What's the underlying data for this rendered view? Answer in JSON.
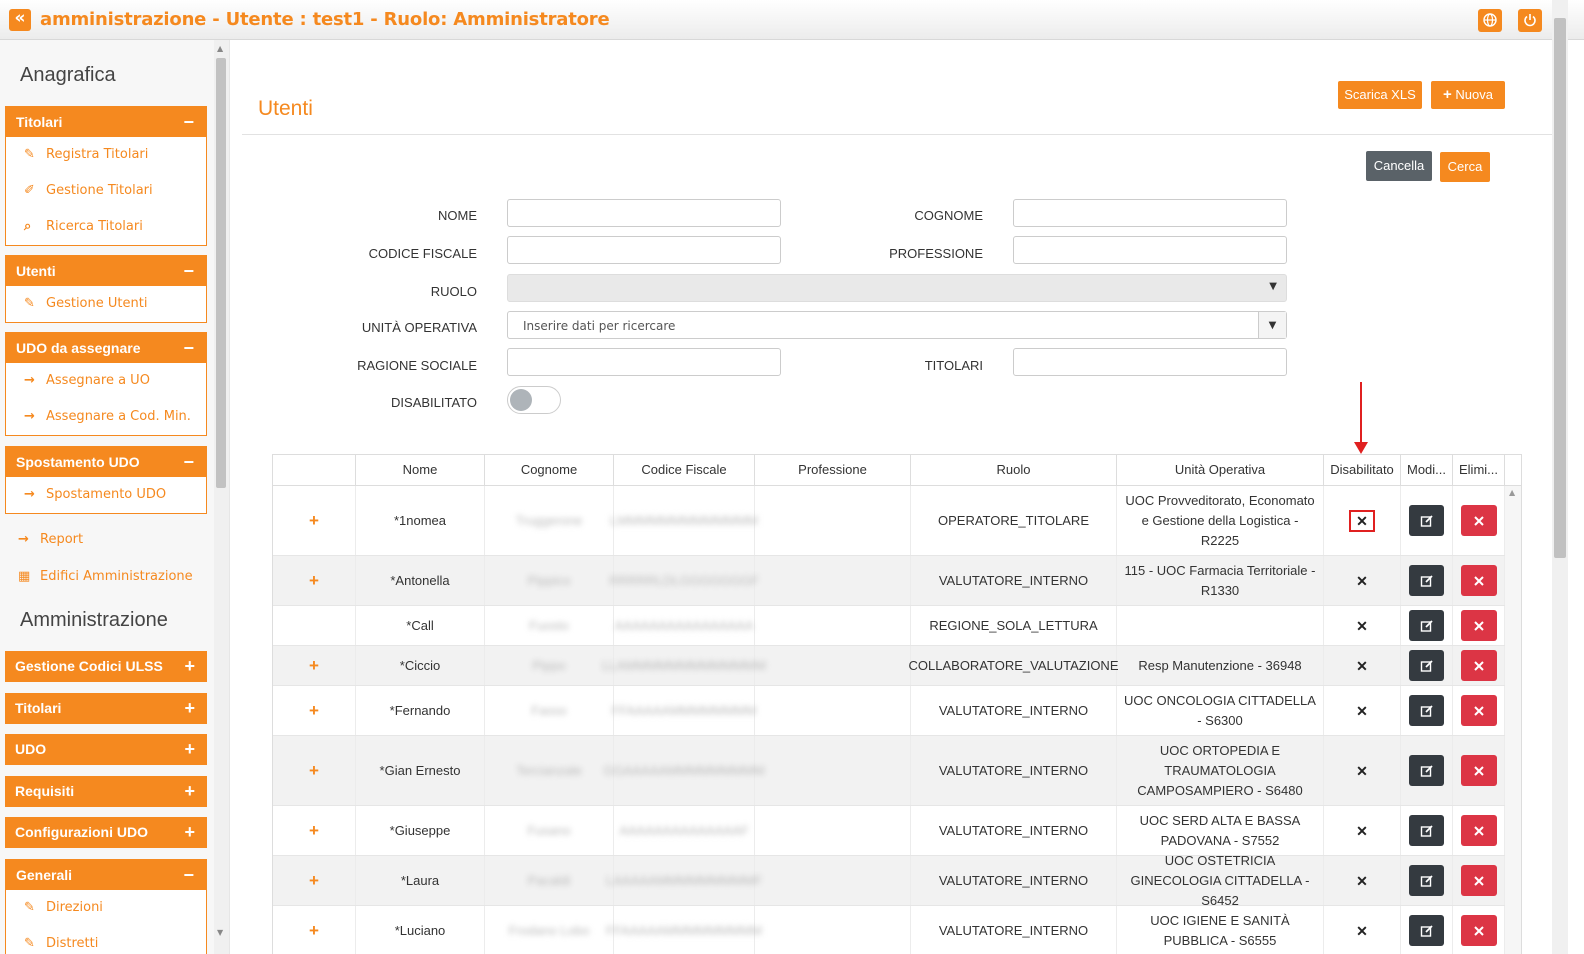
{
  "topbar": {
    "collapse_icon": "«",
    "title": "amministrazione - Utente : test1 - Ruolo: Amministratore",
    "globe_icon": "globe-icon",
    "power_icon": "power-icon"
  },
  "sidebar": {
    "section1": "Anagrafica",
    "titolari": {
      "label": "Titolari",
      "sign": "−",
      "items": [
        {
          "icon": "user-edit-icon",
          "label": "Registra Titolari"
        },
        {
          "icon": "edit-icon",
          "label": "Gestione Titolari"
        },
        {
          "icon": "search-icon",
          "label": "Ricerca Titolari"
        }
      ]
    },
    "utenti": {
      "label": "Utenti",
      "sign": "−",
      "items": [
        {
          "icon": "user-edit-icon",
          "label": "Gestione Utenti"
        }
      ]
    },
    "udo_assegnare": {
      "label": "UDO da assegnare",
      "sign": "−",
      "items": [
        {
          "icon": "arrow-right-icon",
          "label": "Assegnare a UO"
        },
        {
          "icon": "arrow-right-icon",
          "label": "Assegnare a Cod. Min."
        }
      ]
    },
    "spostamento": {
      "label": "Spostamento UDO",
      "sign": "−",
      "items": [
        {
          "icon": "arrow-right-icon",
          "label": "Spostamento UDO"
        }
      ]
    },
    "report": "Report",
    "edifici": "Edifici Amministrazione",
    "section2": "Amministrazione",
    "collapsed": [
      {
        "label": "Gestione Codici ULSS",
        "sign": "+"
      },
      {
        "label": "Titolari",
        "sign": "+"
      },
      {
        "label": "UDO",
        "sign": "+"
      },
      {
        "label": "Requisiti",
        "sign": "+"
      },
      {
        "label": "Configurazioni UDO",
        "sign": "+"
      }
    ],
    "generali": {
      "label": "Generali",
      "sign": "−",
      "items": [
        {
          "icon": "user-edit-icon",
          "label": "Direzioni"
        },
        {
          "icon": "user-edit-icon",
          "label": "Distretti"
        }
      ]
    }
  },
  "main": {
    "page_title": "Utenti",
    "scarica_label": "Scarica XLS",
    "nuova_label": "Nuova",
    "cancella_label": "Cancella",
    "cerca_label": "Cerca",
    "form": {
      "nome": "NOME",
      "cognome": "COGNOME",
      "codice_fiscale": "CODICE FISCALE",
      "professione": "PROFESSIONE",
      "ruolo": "RUOLO",
      "unita": "UNITÀ OPERATIVA",
      "unita_placeholder": "Inserire dati per ricercare",
      "ragione": "RAGIONE SOCIALE",
      "titolari": "TITOLARI",
      "disabilitato": "DISABILITATO"
    },
    "columns": [
      "",
      "Nome",
      "Cognome",
      "Codice Fiscale",
      "Professione",
      "Ruolo",
      "Unità Operativa",
      "Disabilitato",
      "Modi...",
      "Elimi..."
    ],
    "rows": [
      {
        "expand": "+",
        "nome": "*1nomea",
        "cognome": "Truggerone",
        "cf": "LMMMMMMMMMMMMM",
        "ruolo": "OPERATORE_TITOLARE",
        "unita": "UOC Provveditorato, Economato e Gestione della Logistica - R2225",
        "dis": "✕"
      },
      {
        "expand": "+",
        "nome": "*Antonella",
        "cognome": "Pippico",
        "cf": "RRRRRLDLGGGGGGGF",
        "ruolo": "VALUTATORE_INTERNO",
        "unita": "115 - UOC Farmacia Territoriale - R1330",
        "dis": "✕"
      },
      {
        "expand": "",
        "nome": "*Call",
        "cognome": "Fuosto",
        "cf": "AAAAAAAAAAAAAAAA",
        "ruolo": "REGIONE_SOLA_LETTURA",
        "unita": "",
        "dis": "✕"
      },
      {
        "expand": "+",
        "nome": "*Ciccio",
        "cognome": "Pippo",
        "cf": "LLAMMMMMMMMMMMMM",
        "ruolo": "COLLABORATORE_VALUTAZIONE",
        "unita": "Resp Manutenzione - 36948",
        "dis": "✕"
      },
      {
        "expand": "+",
        "nome": "*Fernando",
        "cognome": "Fasso",
        "cf": "FFAAAAAMMMMMMMM",
        "ruolo": "VALUTATORE_INTERNO",
        "unita": "UOC ONCOLOGIA CITTADELLA - S6300",
        "dis": "✕"
      },
      {
        "expand": "+",
        "nome": "*Gian Ernesto",
        "cognome": "Tercianzale",
        "cf": "GGAAAAAMMMMMMMMM",
        "ruolo": "VALUTATORE_INTERNO",
        "unita": "UOC ORTOPEDIA E TRAUMATOLOGIA CAMPOSAMPIERO - S6480",
        "dis": "✕"
      },
      {
        "expand": "+",
        "nome": "*Giuseppe",
        "cognome": "Fusano",
        "cf": "AAAAAAAAAAAAAAF",
        "ruolo": "VALUTATORE_INTERNO",
        "unita": "UOC SERD ALTA E BASSA PADOVANA - S7552",
        "dis": "✕"
      },
      {
        "expand": "+",
        "nome": "*Laura",
        "cognome": "Pacaldi",
        "cf": "LAAAAAMMMMMMMMMF",
        "ruolo": "VALUTATORE_INTERNO",
        "unita": "UOC OSTETRICIA GINECOLOGIA CITTADELLA - S6452",
        "dis": "✕"
      },
      {
        "expand": "+",
        "nome": "*Luciano",
        "cognome": "Frodano Lobo",
        "cf": "FFAAAAAMMMMMMMMM",
        "ruolo": "VALUTATORE_INTERNO",
        "unita": "UOC IGIENE E SANITÀ PUBBLICA - S6555",
        "dis": "✕"
      }
    ]
  },
  "colors": {
    "accent": "#f5891f",
    "dark_btn": "#343a40",
    "delete_btn": "#dc3545",
    "annotation": "#e02020"
  }
}
